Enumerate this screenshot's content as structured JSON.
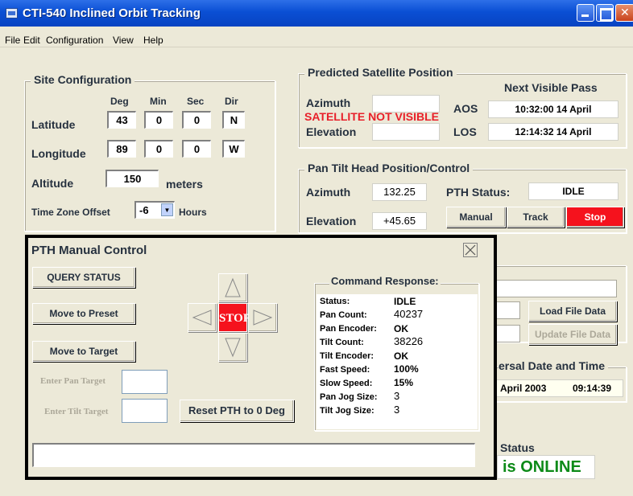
{
  "window": {
    "title": "CTI-540 Inclined Orbit Tracking"
  },
  "menu": [
    {
      "label": "File"
    },
    {
      "label": "Edit"
    },
    {
      "label": "Configuration"
    },
    {
      "label": "View"
    },
    {
      "label": "Help"
    }
  ],
  "site": {
    "title": "Site Configuration",
    "headers": {
      "deg": "Deg",
      "min": "Min",
      "sec": "Sec",
      "dir": "Dir"
    },
    "latitude": {
      "label": "Latitude",
      "deg": "43",
      "min": "0",
      "sec": "0",
      "dir": "N"
    },
    "longitude": {
      "label": "Longitude",
      "deg": "89",
      "min": "0",
      "sec": "0",
      "dir": "W"
    },
    "altitude": {
      "label": "Altitude",
      "value": "150",
      "unit": "meters"
    },
    "timezone": {
      "label": "Time Zone Offset",
      "value": "-6",
      "unit": "Hours"
    }
  },
  "predicted": {
    "title": "Predicted Satellite Position",
    "azimuth_label": "Azimuth",
    "elevation_label": "Elevation",
    "warning": "SATELLITE NOT VISIBLE",
    "next_pass_title": "Next Visible Pass",
    "aos_label": "AOS",
    "aos_value": "10:32:00  14 April",
    "los_label": "LOS",
    "los_value": "12:14:32  14 April"
  },
  "pan_tilt": {
    "title": "Pan Tilt Head Position/Control",
    "azimuth_label": "Azimuth",
    "azimuth_value": "132.25",
    "elevation_label": "Elevation",
    "elevation_value": "+45.65",
    "status_label": "PTH Status:",
    "status_value": "IDLE",
    "manual_label": "Manual",
    "track_label": "Track",
    "stop_label": "Stop"
  },
  "background_right": {
    "load_label": "Load File Data",
    "update_label": "Update File Data",
    "universal_title": "ersal Date and Time",
    "date_value": "April 2003",
    "time_value": "09:14:39",
    "status_title": "Status",
    "online_text": "is ONLINE"
  },
  "pth_dialog": {
    "title": "PTH Manual Control",
    "query_label": "QUERY STATUS",
    "preset_label": "Move to Preset",
    "target_label": "Move to Target",
    "pan_target_label": "Enter Pan Target",
    "tilt_target_label": "Enter Tilt Target",
    "reset_label": "Reset PTH  to 0 Deg",
    "stop_label": "STOP",
    "response_title": "Command Response:",
    "response": [
      {
        "label": "Status:",
        "value": "IDLE"
      },
      {
        "label": "Pan Count:",
        "value": "40237"
      },
      {
        "label": "Pan Encoder:",
        "value": "OK"
      },
      {
        "label": "Tilt Count:",
        "value": "38226"
      },
      {
        "label": "Tilt Encoder:",
        "value": "OK"
      },
      {
        "label": "Fast Speed:",
        "value": "100%"
      },
      {
        "label": "Slow Speed:",
        "value": "15%"
      },
      {
        "label": "Pan Jog Size:",
        "value": "3"
      },
      {
        "label": "Tilt Jog Size:",
        "value": "3"
      }
    ]
  },
  "colors": {
    "title_bar": "#0a4fd4",
    "stop_red": "#f5121d",
    "warning_red": "#e8202a",
    "online_green": "#0c8a18",
    "window_bg": "#ece9d8"
  }
}
